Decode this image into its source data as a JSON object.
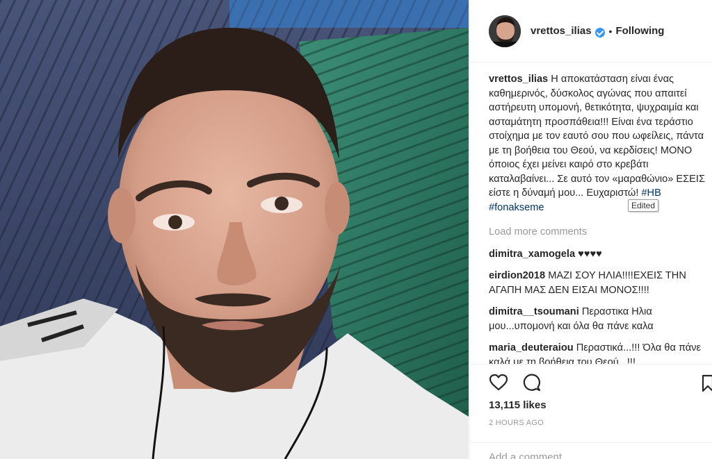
{
  "post": {
    "photo_alt": "selfie",
    "header": {
      "username": "vrettos_ilias",
      "separator": "•",
      "follow_status": "Following"
    },
    "caption": {
      "username": "vrettos_ilias",
      "text": "Η αποκατάσταση είναι ένας καθημερινός, δύσκολος αγώνας που απαιτεί αστήρευτη υπομονή, θετικότητα, ψυχραιμία και ασταμάτητη προσπάθεια!!! Είναι ένα τεράστιο στοίχημα με τον εαυτό σου που ωφείλεις, πάντα με τη βοήθεια του Θεού, να κερδίσεις! ΜΟΝΟ όποιος έχει μείνει καιρό στο κρεβάτι καταλαβαίνει... Σε αυτό τον «μαραθώνιο» ΕΣΕΙΣ είστε η δύναμή μου... Ευχαριστώ!",
      "hashtags": [
        "#HB",
        "#fonakseme"
      ],
      "tooltip": "Edited"
    },
    "load_more": "Load more comments",
    "comments": [
      {
        "username": "dimitra_xamogela",
        "text": "♥♥♥♥"
      },
      {
        "username": "eirdion2018",
        "text": "ΜΑΖΙ ΣΟΥ ΗΛΙΑ!!!!ΕΧΕΙΣ ΤΗΝ ΑΓΑΠΗ ΜΑΣ ΔΕΝ ΕΙΣΑΙ ΜΟΝΟΣ!!!!"
      },
      {
        "username": "dimitra__tsoumani",
        "text": "Περαστικα Ηλια μου...υπομονή και όλα θα πάνε καλα"
      },
      {
        "username": "maria_deuteraiou",
        "text": "Περαστικά...!!! Όλα θα πάνε καλά με τη βοήθεια του Θεού...!!!"
      }
    ],
    "likes": "13,115 likes",
    "time": "2 HOURS AGO",
    "add_comment_placeholder": "Add a comment..."
  },
  "icons": {
    "like": "heart-icon",
    "comment": "comment-icon",
    "save": "bookmark-icon",
    "verified": "verified-badge-icon"
  },
  "colors": {
    "hashtag": "#003569",
    "verified": "#3897f0",
    "muted": "#999999",
    "text": "#262626"
  }
}
